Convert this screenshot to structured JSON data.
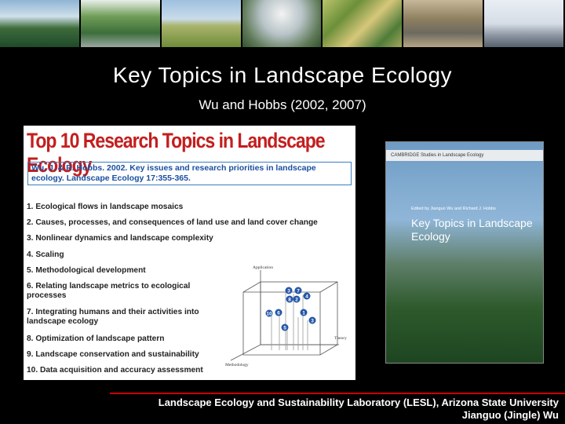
{
  "slide": {
    "title": "Key Topics in Landscape Ecology",
    "subtitle": "Wu and Hobbs (2002, 2007)"
  },
  "poster": {
    "heading": "Top 10 Research Topics in Landscape Ecology",
    "reference": "Wu, J. & R. Hobbs. 2002. Key issues and research priorities in landscape ecology. Landscape Ecology 17:355-365.",
    "topics": [
      "1. Ecological flows in landscape mosaics",
      "2. Causes, processes, and consequences of land use and land cover change",
      "3. Nonlinear dynamics and landscape complexity",
      "4. Scaling",
      "5. Methodological development",
      "6. Relating landscape metrics to ecological processes",
      "7. Integrating humans and their activities into landscape ecology",
      "8. Optimization of landscape pattern",
      "9. Landscape conservation and sustainability",
      "10. Data acquisition and accuracy assessment"
    ],
    "diagram": {
      "axis_application": "Application",
      "axis_theory": "Theory",
      "axis_methodology": "Methodology",
      "markers": [
        "3",
        "7",
        "8",
        "2",
        "4",
        "10",
        "6",
        "1",
        "3",
        "5"
      ]
    }
  },
  "book": {
    "series": "CAMBRIDGE  Studies in Landscape Ecology",
    "editors": "Edited by Jianguo Wu and Richard J. Hobbs",
    "title": "Key Topics in Landscape Ecology"
  },
  "footer": {
    "line1": "Landscape Ecology and Sustainability Laboratory (LESL), Arizona State University",
    "line2": "Jianguo (Jingle) Wu"
  },
  "colors": {
    "background": "#000000",
    "accent": "#cc0000",
    "poster_heading": "#c41e1e"
  }
}
